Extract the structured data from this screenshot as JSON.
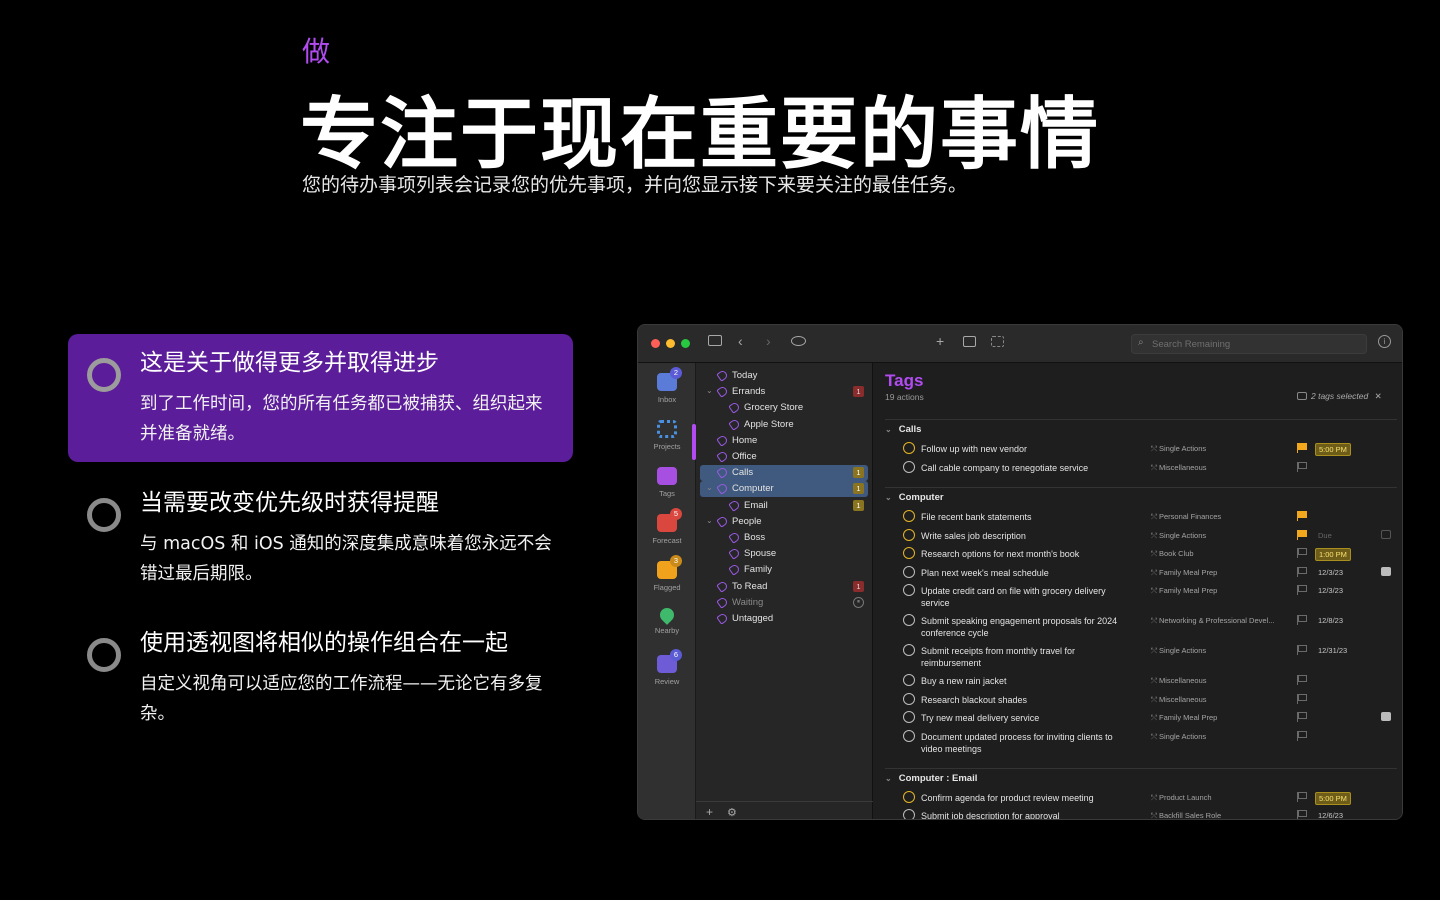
{
  "hero": {
    "eyebrow": "做",
    "title": "专注于现在重要的事情",
    "subtitle": "您的待办事项列表会记录您的优先事项，并向您显示接下来要关注的最佳任务。"
  },
  "features": [
    {
      "title": "这是关于做得更多并取得进步",
      "desc": "到了工作时间，您的所有任务都已被捕获、组织起来并准备就绪。",
      "active": true
    },
    {
      "title": "当需要改变优先级时获得提醒",
      "desc": "与 macOS 和 iOS 通知的深度集成意味着您永远不会错过最后期限。",
      "active": false
    },
    {
      "title": "使用透视图将相似的操作组合在一起",
      "desc": "自定义视角可以适应您的工作流程——无论它有多复杂。",
      "active": false
    }
  ],
  "app": {
    "search_placeholder": "Search Remaining",
    "toolbar_icons": [
      "sidebar-icon",
      "back-icon",
      "forward-icon",
      "eye-icon",
      "plus-icon",
      "inbox-capture-icon",
      "focus-icon",
      "info-icon"
    ],
    "colors": {
      "accent": "#b24cf2",
      "selection": "#3f5a7e",
      "due": "#e5b524",
      "flag": "#f2a71d"
    },
    "rail": [
      {
        "label": "Inbox",
        "badge": "2",
        "color": "#5b7bd8",
        "badge_color": "#5b5bd6"
      },
      {
        "label": "Projects",
        "badge": "",
        "color": "#4a90e2",
        "badge_color": ""
      },
      {
        "label": "Tags",
        "badge": "",
        "color": "#a64fe0",
        "badge_color": ""
      },
      {
        "label": "Forecast",
        "badge": "5",
        "color": "#d9473f",
        "badge_color": "#d9473f"
      },
      {
        "label": "Flagged",
        "badge": "3",
        "color": "#f0a21c",
        "badge_color": "#c98a1a"
      },
      {
        "label": "Nearby",
        "badge": "",
        "color": "#3fb96b",
        "badge_color": ""
      },
      {
        "label": "Review",
        "badge": "6",
        "color": "#6e5bd6",
        "badge_color": "#5b5bd6"
      }
    ],
    "outline": [
      {
        "label": "Today",
        "indent": 0,
        "chev": false,
        "count": "",
        "count_style": "",
        "selected": false,
        "dim": false
      },
      {
        "label": "Errands",
        "indent": 0,
        "chev": true,
        "count": "1",
        "count_style": "red",
        "selected": false,
        "dim": false
      },
      {
        "label": "Grocery Store",
        "indent": 1,
        "chev": false,
        "count": "",
        "count_style": "",
        "selected": false,
        "dim": false
      },
      {
        "label": "Apple Store",
        "indent": 1,
        "chev": false,
        "count": "",
        "count_style": "",
        "selected": false,
        "dim": false
      },
      {
        "label": "Home",
        "indent": 0,
        "chev": false,
        "count": "",
        "count_style": "",
        "selected": false,
        "dim": false
      },
      {
        "label": "Office",
        "indent": 0,
        "chev": false,
        "count": "",
        "count_style": "",
        "selected": false,
        "dim": false
      },
      {
        "label": "Calls",
        "indent": 0,
        "chev": false,
        "count": "1",
        "count_style": "yel",
        "selected": true,
        "dim": false
      },
      {
        "label": "Computer",
        "indent": 0,
        "chev": true,
        "count": "1",
        "count_style": "yel",
        "selected": true,
        "dim": false
      },
      {
        "label": "Email",
        "indent": 1,
        "chev": false,
        "count": "1",
        "count_style": "yel",
        "selected": false,
        "dim": false
      },
      {
        "label": "People",
        "indent": 0,
        "chev": true,
        "count": "",
        "count_style": "",
        "selected": false,
        "dim": false
      },
      {
        "label": "Boss",
        "indent": 1,
        "chev": false,
        "count": "",
        "count_style": "",
        "selected": false,
        "dim": false
      },
      {
        "label": "Spouse",
        "indent": 1,
        "chev": false,
        "count": "",
        "count_style": "",
        "selected": false,
        "dim": false
      },
      {
        "label": "Family",
        "indent": 1,
        "chev": false,
        "count": "",
        "count_style": "",
        "selected": false,
        "dim": false
      },
      {
        "label": "To Read",
        "indent": 0,
        "chev": false,
        "count": "1",
        "count_style": "red",
        "selected": false,
        "dim": false
      },
      {
        "label": "Waiting",
        "indent": 0,
        "chev": false,
        "count": "⏸",
        "count_style": "gray",
        "selected": false,
        "dim": true
      },
      {
        "label": "Untagged",
        "indent": 0,
        "chev": false,
        "count": "",
        "count_style": "",
        "selected": false,
        "dim": false
      }
    ],
    "footer": {
      "add": "+",
      "settings": "⚙"
    },
    "main": {
      "title": "Tags",
      "subtitle": "19 actions",
      "selection": "2 tags selected",
      "groups": [
        {
          "name": "Calls",
          "tasks": [
            {
              "name": "Follow up with new vendor",
              "project": "Single Actions",
              "due": true,
              "flag": true,
              "date": "5:00 PM",
              "date_style": "hl",
              "note": ""
            },
            {
              "name": "Call cable company to renegotiate service",
              "project": "Miscellaneous",
              "due": false,
              "flag": false,
              "date": "",
              "date_style": "",
              "note": ""
            }
          ]
        },
        {
          "name": "Computer",
          "tasks": [
            {
              "name": "File recent bank statements",
              "project": "Personal Finances",
              "due": true,
              "flag": true,
              "date": "",
              "date_style": "",
              "note": ""
            },
            {
              "name": "Write sales job description",
              "project": "Single Actions",
              "due": true,
              "flag": true,
              "date": "Due",
              "date_style": "muted",
              "note": "dim"
            },
            {
              "name": "Research options for next month's book",
              "project": "Book Club",
              "due": true,
              "flag": false,
              "date": "1:00 PM",
              "date_style": "hl",
              "note": ""
            },
            {
              "name": "Plan next week's meal schedule",
              "project": "Family Meal Prep",
              "due": false,
              "flag": false,
              "date": "12/3/23",
              "date_style": "",
              "note": "on"
            },
            {
              "name": "Update credit card on file with grocery delivery service",
              "project": "Family Meal Prep",
              "due": false,
              "flag": false,
              "date": "12/3/23",
              "date_style": "",
              "note": ""
            },
            {
              "name": "Submit speaking engagement proposals for 2024 conference cycle",
              "project": "Networking & Professional Devel...",
              "due": false,
              "flag": false,
              "date": "12/8/23",
              "date_style": "",
              "note": ""
            },
            {
              "name": "Submit receipts from monthly travel for reimbursement",
              "project": "Single Actions",
              "due": false,
              "flag": false,
              "date": "12/31/23",
              "date_style": "",
              "note": ""
            },
            {
              "name": "Buy a new rain jacket",
              "project": "Miscellaneous",
              "due": false,
              "flag": false,
              "date": "",
              "date_style": "",
              "note": ""
            },
            {
              "name": "Research blackout shades",
              "project": "Miscellaneous",
              "due": false,
              "flag": false,
              "date": "",
              "date_style": "",
              "note": ""
            },
            {
              "name": "Try new meal delivery service",
              "project": "Family Meal Prep",
              "due": false,
              "flag": false,
              "date": "",
              "date_style": "",
              "note": "on"
            },
            {
              "name": "Document updated process for inviting clients to video meetings",
              "project": "Single Actions",
              "due": false,
              "flag": false,
              "date": "",
              "date_style": "",
              "note": ""
            }
          ]
        },
        {
          "name": "Computer : Email",
          "tasks": [
            {
              "name": "Confirm agenda for product review meeting",
              "project": "Product Launch",
              "due": true,
              "flag": false,
              "date": "5:00 PM",
              "date_style": "hl",
              "note": ""
            },
            {
              "name": "Submit job description for approval",
              "project": "Backfill Sales Role",
              "due": false,
              "flag": false,
              "date": "12/6/23",
              "date_style": "",
              "note": ""
            }
          ]
        }
      ]
    }
  }
}
